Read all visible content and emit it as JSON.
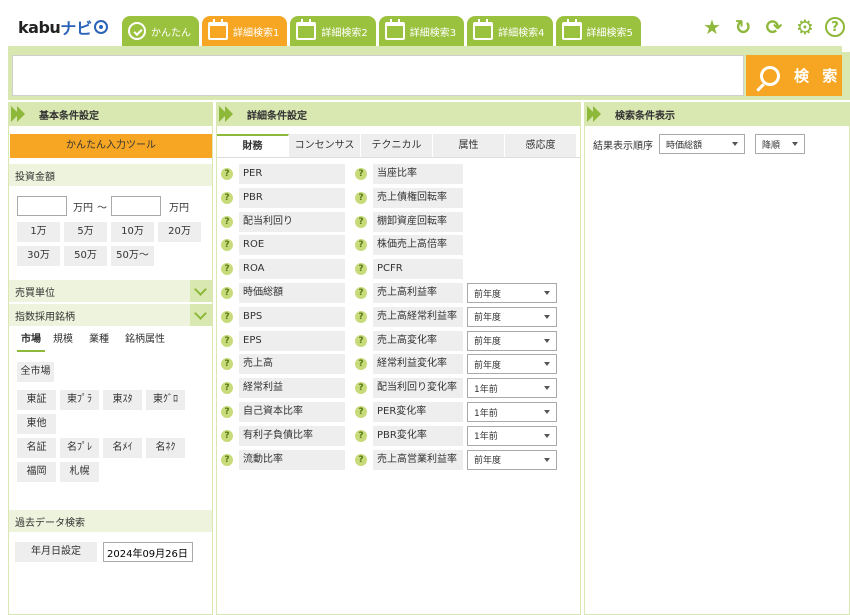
{
  "logo": {
    "kabu": "kabu",
    "navi": "ナビ"
  },
  "tabs": [
    {
      "label": "かんたん",
      "icon": "search-icon",
      "active": false
    },
    {
      "label": "詳細検索1",
      "icon": "calendar-icon",
      "active": true
    },
    {
      "label": "詳細検索2",
      "icon": "calendar-icon",
      "active": false
    },
    {
      "label": "詳細検索3",
      "icon": "calendar-icon",
      "active": false
    },
    {
      "label": "詳細検索4",
      "icon": "calendar-icon",
      "active": false
    },
    {
      "label": "詳細検索5",
      "icon": "calendar-icon",
      "active": false
    }
  ],
  "tools": {
    "star": "★",
    "undo": "↻",
    "refresh": "⟳",
    "settings": "⚙",
    "help": "?"
  },
  "search": {
    "value": "",
    "button": "検 索"
  },
  "panels": {
    "basic": "基本条件設定",
    "detail": "詳細条件設定",
    "display": "検索条件表示"
  },
  "basic": {
    "easy_tool": "かんたん入力ツール",
    "investment": "投資金額",
    "unit": "万円",
    "tilde": "～",
    "amounts": [
      "1万",
      "5万",
      "10万",
      "20万",
      "30万",
      "50万",
      "50万～"
    ],
    "trade_unit": "売買単位",
    "index": "指数採用銘柄",
    "subtabs": [
      "市場",
      "規模",
      "業種",
      "銘柄属性"
    ],
    "markets": [
      "全市場",
      "東証",
      "東ﾌﾟﾗ",
      "東ｽﾀ",
      "東ｸﾞﾛ",
      "東他",
      "名証",
      "名ﾌﾟﾚ",
      "名ﾒｲ",
      "名ﾈｸ",
      "福岡",
      "札幌"
    ],
    "past": "過去データ検索",
    "date_btn": "年月日設定",
    "date_value": "2024年09月26日"
  },
  "detail": {
    "tabs": [
      "財務",
      "コンセンサス",
      "テクニカル",
      "属性",
      "感応度"
    ],
    "left_items": [
      "PER",
      "PBR",
      "配当利回り",
      "ROE",
      "ROA",
      "時価総額",
      "BPS",
      "EPS",
      "売上高",
      "経常利益",
      "自己資本比率",
      "有利子負債比率",
      "流動比率"
    ],
    "right_items": [
      {
        "label": "当座比率",
        "select": ""
      },
      {
        "label": "売上債権回転率",
        "select": ""
      },
      {
        "label": "棚卸資産回転率",
        "select": ""
      },
      {
        "label": "株価売上高倍率",
        "select": ""
      },
      {
        "label": "PCFR",
        "select": ""
      },
      {
        "label": "売上高利益率",
        "select": "前年度"
      },
      {
        "label": "売上高経常利益率",
        "select": "前年度"
      },
      {
        "label": "売上高変化率",
        "select": "前年度"
      },
      {
        "label": "経常利益変化率",
        "select": "前年度"
      },
      {
        "label": "配当利回り変化率",
        "select": "1年前"
      },
      {
        "label": "PER変化率",
        "select": "1年前"
      },
      {
        "label": "PBR変化率",
        "select": "1年前"
      },
      {
        "label": "売上高営業利益率",
        "select": "前年度"
      }
    ]
  },
  "display": {
    "sort_label": "結果表示順序",
    "sort_key": "時価総額",
    "sort_order": "降順"
  },
  "colors": {
    "green": "#8db83a",
    "light_green": "#d9e7b0",
    "orange": "#f6a623"
  }
}
